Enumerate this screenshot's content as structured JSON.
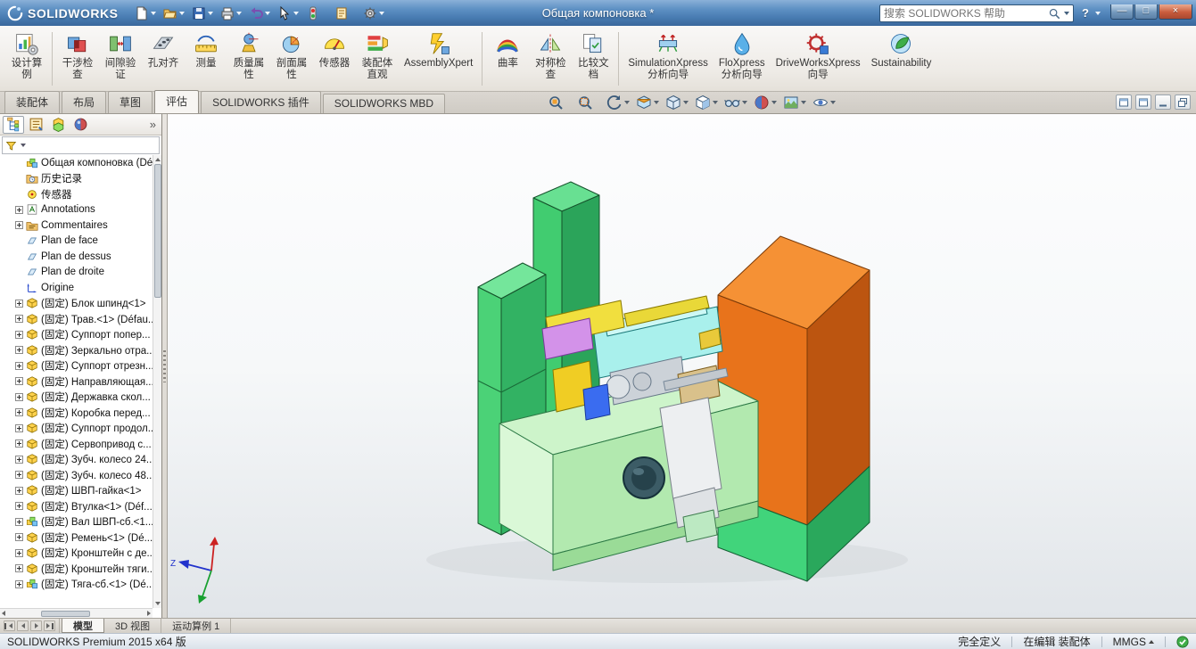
{
  "window": {
    "brand": "SOLIDWORKS",
    "title": "Общая компоновка *",
    "search_placeholder": "搜索 SOLIDWORKS 帮助",
    "help_label": "?",
    "controls": {
      "minimize": "—",
      "maximize": "□",
      "close": "×"
    }
  },
  "icons": {
    "logo": "dassault-swirl",
    "search": "magnifier",
    "filter": "funnel",
    "status_ok": "green-check-circle",
    "triad": "xyz-axes"
  },
  "quickbar": {
    "buttons": [
      {
        "name": "new-document-button",
        "icon": "t-new",
        "caret": true
      },
      {
        "name": "open-document-button",
        "icon": "t-open",
        "caret": true
      },
      {
        "name": "save-button",
        "icon": "t-save",
        "caret": true
      },
      {
        "name": "print-button",
        "icon": "t-print",
        "caret": true
      },
      {
        "name": "undo-button",
        "icon": "t-undo",
        "caret": true
      },
      {
        "name": "select-button",
        "icon": "t-select",
        "caret": true
      },
      {
        "name": "rebuild-button",
        "icon": "t-rebuild",
        "caret": false
      },
      {
        "name": "file-properties-button",
        "icon": "t-props",
        "caret": false
      },
      {
        "name": "options-button",
        "icon": "t-options",
        "caret": true
      }
    ]
  },
  "ribbon": {
    "groups": [
      {
        "buttons": [
          {
            "name": "design-study-button",
            "icon": "r-design",
            "label": "设计算\n例"
          }
        ]
      },
      {
        "buttons": [
          {
            "name": "interference-detection-button",
            "icon": "r-interfere",
            "label": "干涉检\n查"
          },
          {
            "name": "clearance-verification-button",
            "icon": "r-clearance",
            "label": "间隙验\n证"
          },
          {
            "name": "hole-alignment-button",
            "icon": "r-holealign",
            "label": "孔对齐"
          },
          {
            "name": "measure-button",
            "icon": "r-measure",
            "label": "测量"
          },
          {
            "name": "mass-properties-button",
            "icon": "r-mass",
            "label": "质量属\n性"
          },
          {
            "name": "section-properties-button",
            "icon": "r-sectionp",
            "label": "剖面属\n性"
          },
          {
            "name": "sensor-button",
            "icon": "r-sensor",
            "label": "传感器"
          },
          {
            "name": "assembly-visualization-button",
            "icon": "r-visual",
            "label": "装配体\n直观"
          },
          {
            "name": "assemblyxpert-button",
            "icon": "r-xpert",
            "label": "AssemblyXpert"
          }
        ]
      },
      {
        "buttons": [
          {
            "name": "curvature-button",
            "icon": "r-curv",
            "label": "曲率"
          },
          {
            "name": "symmetry-check-button",
            "icon": "r-symm",
            "label": "对称检\n查"
          },
          {
            "name": "compare-documents-button",
            "icon": "r-compare",
            "label": "比较文\n档"
          }
        ]
      },
      {
        "buttons": [
          {
            "name": "simulationxpress-button",
            "icon": "r-simx",
            "label": "SimulationXpress\n分析向导"
          },
          {
            "name": "floxpress-button",
            "icon": "r-flox",
            "label": "FloXpress\n分析向导"
          },
          {
            "name": "driveworksxpress-button",
            "icon": "r-dwx",
            "label": "DriveWorksXpress\n向导"
          },
          {
            "name": "sustainability-button",
            "icon": "r-sust",
            "label": "Sustainability"
          }
        ]
      }
    ]
  },
  "tabs": {
    "items": [
      {
        "label": "装配体"
      },
      {
        "label": "布局"
      },
      {
        "label": "草图"
      },
      {
        "label": "评估",
        "active": true
      },
      {
        "label": "SOLIDWORKS 插件"
      },
      {
        "label": "SOLIDWORKS MBD"
      }
    ]
  },
  "headsup": {
    "buttons": [
      {
        "name": "zoom-fit-button",
        "icon": "h-zoomfit",
        "caret": false
      },
      {
        "name": "zoom-area-button",
        "icon": "h-zoomarea",
        "caret": false
      },
      {
        "name": "previous-view-button",
        "icon": "h-prev",
        "caret": true
      },
      {
        "name": "section-view-button",
        "icon": "h-section",
        "caret": true
      },
      {
        "name": "view-orientation-button",
        "icon": "h-orient",
        "caret": true
      },
      {
        "name": "display-style-button",
        "icon": "h-display",
        "caret": true
      },
      {
        "name": "hide-show-items-button",
        "icon": "h-hideshow",
        "caret": true
      },
      {
        "name": "edit-appearance-button",
        "icon": "h-appear",
        "caret": true
      },
      {
        "name": "apply-scene-button",
        "icon": "h-scene",
        "caret": true
      },
      {
        "name": "view-settings-button",
        "icon": "h-viewset",
        "caret": true
      }
    ]
  },
  "docwin": {
    "buttons": [
      {
        "name": "left-pane-button",
        "icon": "d-win"
      },
      {
        "name": "right-pane-button",
        "icon": "d-win"
      },
      {
        "name": "minimize-document-button",
        "icon": "d-min"
      },
      {
        "name": "restore-document-button",
        "icon": "d-restore"
      }
    ]
  },
  "panel": {
    "more_label": "»",
    "tabs": [
      {
        "name": "featuremanager-tab",
        "icon": "p-feat",
        "active": true
      },
      {
        "name": "propertymanager-tab",
        "icon": "p-prop"
      },
      {
        "name": "configurationmanager-tab",
        "icon": "p-config"
      },
      {
        "name": "displaymanager-tab",
        "icon": "p-display"
      }
    ],
    "tree": [
      {
        "icon": "i-root",
        "label": "Общая компоновка (Dé",
        "expand": false
      },
      {
        "icon": "i-hist",
        "label": "历史记录",
        "expand": false
      },
      {
        "icon": "i-sensor",
        "label": "传感器",
        "expand": false
      },
      {
        "icon": "i-ann",
        "label": "Annotations",
        "expand": true
      },
      {
        "icon": "i-cmt",
        "label": "Commentaires",
        "expand": true
      },
      {
        "icon": "i-plane",
        "label": "Plan de face",
        "expand": false
      },
      {
        "icon": "i-plane",
        "label": "Plan de dessus",
        "expand": false
      },
      {
        "icon": "i-plane",
        "label": "Plan de droite",
        "expand": false
      },
      {
        "icon": "i-origin",
        "label": "Origine",
        "expand": false
      },
      {
        "icon": "i-comp",
        "label": "(固定) Блок шпинд<1>",
        "expand": true
      },
      {
        "icon": "i-comp",
        "label": "(固定) Трав.<1> (Défau...",
        "expand": true
      },
      {
        "icon": "i-comp",
        "label": "(固定) Суппорт попер...",
        "expand": true
      },
      {
        "icon": "i-comp",
        "label": "(固定) Зеркально отра...",
        "expand": true
      },
      {
        "icon": "i-comp",
        "label": "(固定) Суппорт отрезн...",
        "expand": true
      },
      {
        "icon": "i-comp",
        "label": "(固定) Направляющая...",
        "expand": true
      },
      {
        "icon": "i-comp",
        "label": "(固定) Державка скол...",
        "expand": true
      },
      {
        "icon": "i-comp",
        "label": "(固定) Коробка перед...",
        "expand": true
      },
      {
        "icon": "i-comp",
        "label": "(固定) Суппорт продол...",
        "expand": true
      },
      {
        "icon": "i-comp",
        "label": "(固定) Сервопривод с...",
        "expand": true
      },
      {
        "icon": "i-comp",
        "label": "(固定) Зубч. колесо 24...",
        "expand": true
      },
      {
        "icon": "i-comp",
        "label": "(固定) Зубч. колесо 48...",
        "expand": true
      },
      {
        "icon": "i-comp",
        "label": "(固定) ШВП-гайка<1>",
        "expand": true
      },
      {
        "icon": "i-comp",
        "label": "(固定) Втулка<1> (Déf...",
        "expand": true
      },
      {
        "icon": "i-root",
        "label": "(固定) Вал ШВП-сб.<1...",
        "expand": true
      },
      {
        "icon": "i-comp",
        "label": "(固定) Ремень<1> (Dé...",
        "expand": true
      },
      {
        "icon": "i-comp",
        "label": "(固定) Кронштейн с де...",
        "expand": true
      },
      {
        "icon": "i-comp",
        "label": "(固定) Кронштейн тяги...",
        "expand": true
      },
      {
        "icon": "i-root",
        "label": "(固定) Тяга-сб.<1> (Dé...",
        "expand": true
      }
    ]
  },
  "viewport": {
    "triad_z": "Z"
  },
  "bottombar": {
    "tabs": [
      {
        "label": "模型",
        "active": true
      },
      {
        "label": "3D 视图"
      },
      {
        "label": "运动算例 1"
      }
    ]
  },
  "statusbar": {
    "product": "SOLIDWORKS Premium 2015 x64 版",
    "define_state": "完全定义",
    "editing": "在编辑 装配体",
    "units": "MMGS"
  }
}
